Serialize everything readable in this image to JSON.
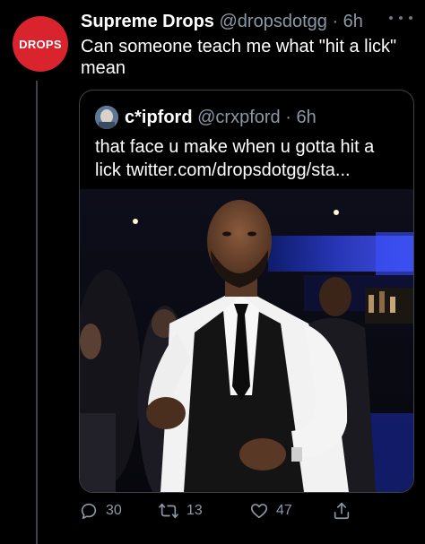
{
  "tweet": {
    "avatar_text": "DROPS",
    "display_name": "Supreme Drops",
    "handle": "@dropsdotgg",
    "separator": " · ",
    "time": "6h",
    "text": "Can someone teach me what \"hit a lick\" mean"
  },
  "quote": {
    "display_name": "c*ipford",
    "handle": "@crxpford",
    "separator": " · ",
    "time": "6h",
    "text": "that face u make when u gotta hit a lick twitter.com/dropsdotgg/sta..."
  },
  "actions": {
    "reply_count": "30",
    "retweet_count": "13",
    "like_count": "47"
  },
  "icons": {
    "more": "more-horizontal-icon",
    "reply": "reply-icon",
    "retweet": "retweet-icon",
    "like": "heart-icon",
    "share": "share-icon"
  },
  "colors": {
    "background": "#000000",
    "text_primary": "#ffffff",
    "text_secondary": "#8b98a5",
    "border": "#3d4246",
    "avatar_red": "#d9232d"
  }
}
